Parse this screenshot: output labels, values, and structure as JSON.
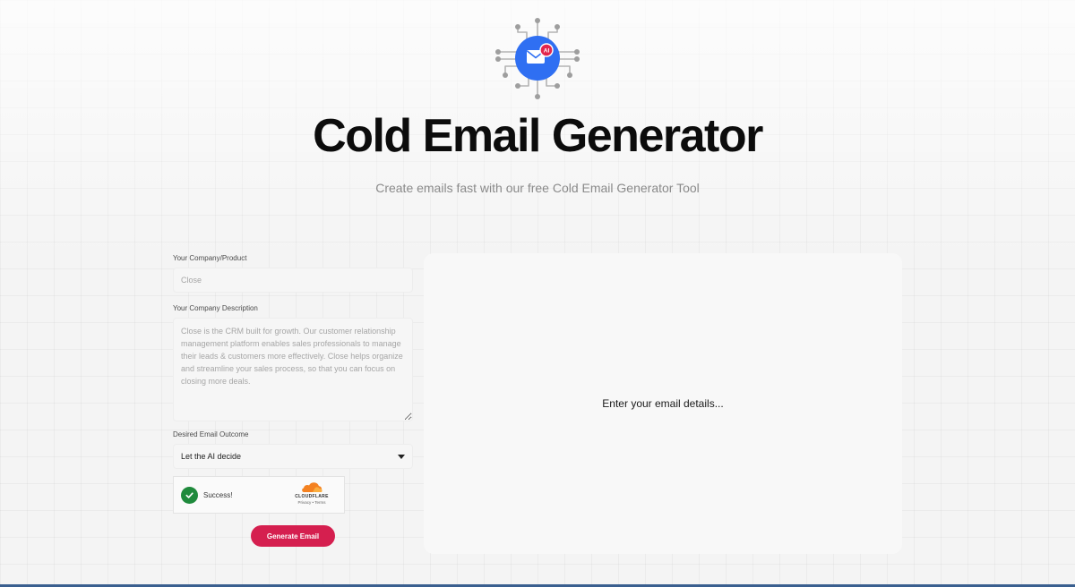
{
  "hero": {
    "icon": "mail-ai-circuit-icon",
    "badge": "AI",
    "title": "Cold Email Generator",
    "subtitle": "Create emails fast with our free Cold Email Generator Tool"
  },
  "form": {
    "company": {
      "label": "Your Company/Product",
      "placeholder": "Close"
    },
    "description": {
      "label": "Your Company Description",
      "placeholder": "Close is the CRM built for growth. Our customer relationship management platform enables sales professionals to manage their leads & customers more effectively. Close helps organize and streamline your sales process, so that you can focus on closing more deals."
    },
    "outcome": {
      "label": "Desired Email Outcome",
      "selected": "Let the AI decide"
    },
    "captcha": {
      "status": "Success!",
      "brand": "CLOUDFLARE",
      "links": "Privacy • Terms"
    },
    "generate_label": "Generate Email"
  },
  "output": {
    "placeholder": "Enter your email details..."
  },
  "colors": {
    "brand_blue": "#2f6ff2",
    "accent_red": "#d51f4f",
    "success_green": "#1f8a3c",
    "cloudflare_orange": "#f48120"
  }
}
